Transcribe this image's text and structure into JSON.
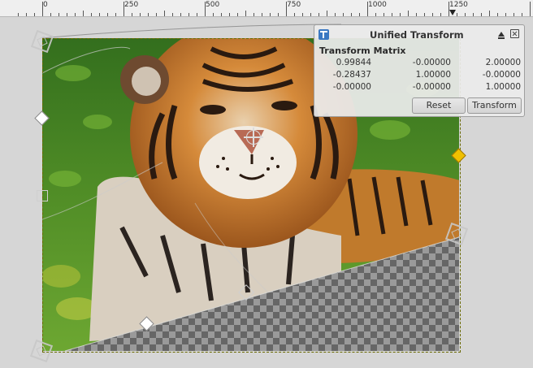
{
  "ruler": {
    "labels": [
      "0",
      "250",
      "500",
      "750",
      "1000",
      "1250"
    ]
  },
  "dialog": {
    "title": "Unified Transform",
    "section_label": "Transform Matrix",
    "matrix": [
      [
        "0.99844",
        "-0.00000",
        "2.00000"
      ],
      [
        "-0.28437",
        "1.00000",
        "-0.00000"
      ],
      [
        "-0.00000",
        "-0.00000",
        "1.00000"
      ]
    ],
    "reset_label": "Reset",
    "transform_label": "Transform"
  },
  "colors": {
    "active_handle": "#f0c000",
    "dialog_icon": "#3a78c2"
  },
  "icons": {
    "dialog_tool": "unified-transform-icon",
    "collapse": "eject-icon",
    "close": "close-icon"
  }
}
